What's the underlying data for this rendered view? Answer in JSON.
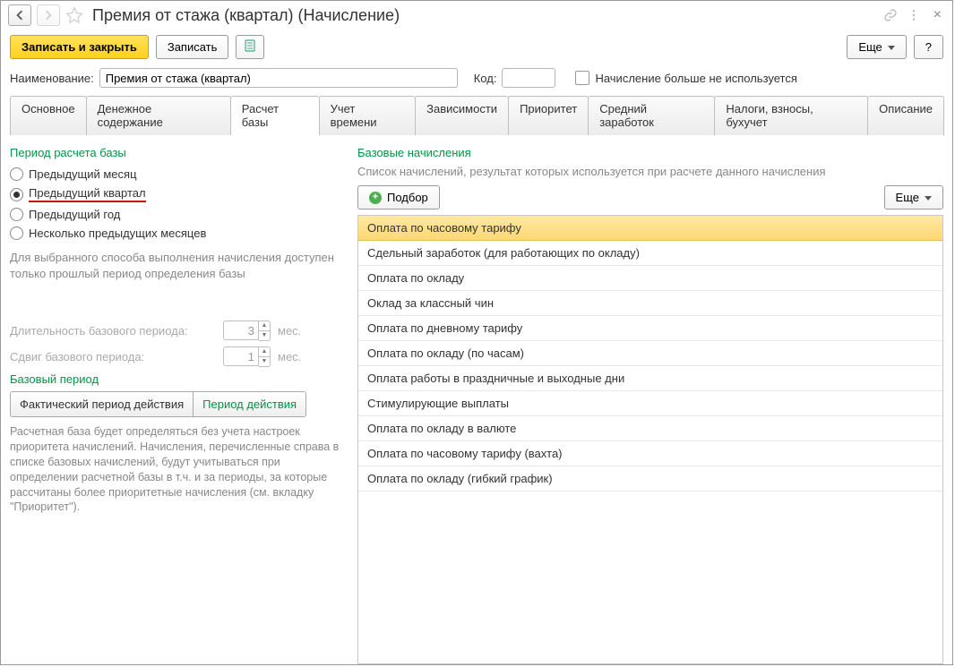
{
  "title": "Премия от стажа (квартал) (Начисление)",
  "toolbar": {
    "save_close": "Записать и закрыть",
    "save": "Записать",
    "more": "Еще",
    "help": "?"
  },
  "form": {
    "name_label": "Наименование:",
    "name_value": "Премия от стажа (квартал)",
    "code_label": "Код:",
    "code_value": "",
    "not_used_label": "Начисление больше не используется"
  },
  "tabs": [
    "Основное",
    "Денежное содержание",
    "Расчет базы",
    "Учет времени",
    "Зависимости",
    "Приоритет",
    "Средний заработок",
    "Налоги, взносы, бухучет",
    "Описание"
  ],
  "left": {
    "section1": "Период расчета базы",
    "radios": [
      "Предыдущий месяц",
      "Предыдущий квартал",
      "Предыдущий год",
      "Несколько предыдущих месяцев"
    ],
    "selected_radio": 1,
    "hint1": "Для выбранного способа выполнения начисления доступен только прошлый период определения базы",
    "duration_label": "Длительность базового периода:",
    "duration_value": "3",
    "shift_label": "Сдвиг базового периода:",
    "shift_value": "1",
    "unit": "мес.",
    "section2": "Базовый период",
    "toggle": [
      "Фактический период действия",
      "Период действия"
    ],
    "toggle_active": 1,
    "hint2": "Расчетная база будет определяться без учета настроек приоритета начислений. Начисления, перечисленные справа в списке базовых начислений, будут учитываться при определении расчетной базы в т.ч. и за периоды, за которые рассчитаны более приоритетные начисления (см. вкладку \"Приоритет\")."
  },
  "right": {
    "section": "Базовые начисления",
    "desc": "Список начислений, результат которых используется при расчете данного начисления",
    "pick": "Подбор",
    "more": "Еще",
    "items": [
      "Оплата по часовому тарифу",
      "Сдельный заработок (для работающих по окладу)",
      "Оплата по окладу",
      "Оклад за классный чин",
      "Оплата по дневному тарифу",
      "Оплата по окладу (по часам)",
      "Оплата работы в праздничные и выходные дни",
      "Стимулирующие выплаты",
      "Оплата по окладу в валюте",
      "Оплата по часовому тарифу (вахта)",
      "Оплата по окладу (гибкий график)"
    ],
    "selected_item": 0
  }
}
